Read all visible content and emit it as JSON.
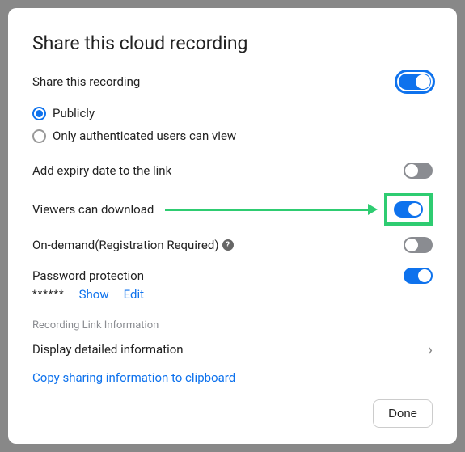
{
  "title": "Share this cloud recording",
  "share_recording": {
    "label": "Share this recording",
    "enabled": true,
    "options": {
      "publicly": "Publicly",
      "authenticated": "Only authenticated users can view",
      "selected": "publicly"
    }
  },
  "expiry": {
    "label": "Add expiry date to the link",
    "enabled": false
  },
  "download": {
    "label": "Viewers can download",
    "enabled": true
  },
  "on_demand": {
    "label": "On-demand(Registration Required)",
    "enabled": false
  },
  "password": {
    "label": "Password protection",
    "enabled": true,
    "masked": "******",
    "show": "Show",
    "edit": "Edit"
  },
  "link_info": {
    "heading": "Recording Link Information",
    "display": "Display detailed information",
    "copy": "Copy sharing information to clipboard"
  },
  "done": "Done"
}
